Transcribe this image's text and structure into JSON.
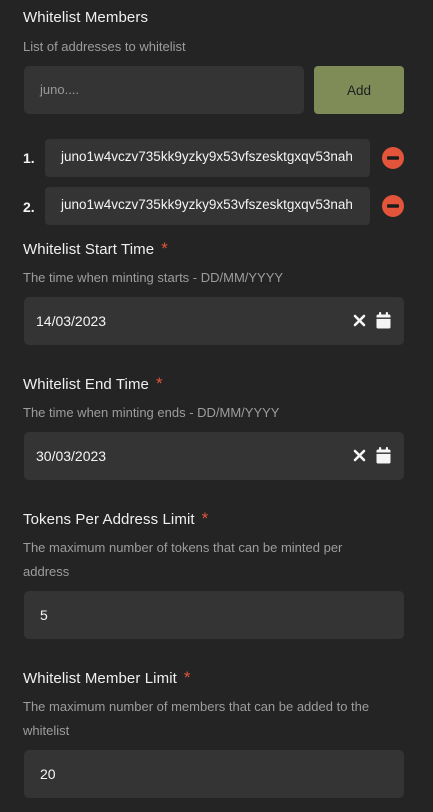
{
  "whitelist_members": {
    "title": "Whitelist Members",
    "description": "List of addresses to whitelist",
    "input_placeholder": "juno....",
    "add_label": "Add",
    "members": [
      {
        "num": "1.",
        "address": "juno1w4vczv735kk9yzky9x53vfszesktgxqv53nah"
      },
      {
        "num": "2.",
        "address": "juno1w4vczv735kk9yzky9x53vfszesktgxqv53nah"
      }
    ]
  },
  "start_time": {
    "title": "Whitelist Start Time",
    "required": "*",
    "description": "The time when minting starts - DD/MM/YYYY",
    "value": "14/03/2023"
  },
  "end_time": {
    "title": "Whitelist End Time",
    "required": "*",
    "description": "The time when minting ends - DD/MM/YYYY",
    "value": "30/03/2023"
  },
  "tokens_limit": {
    "title": "Tokens Per Address Limit",
    "required": "*",
    "description_line1": "The maximum number of tokens that can be minted per",
    "description_line2": "address",
    "value": "5"
  },
  "member_limit": {
    "title": "Whitelist Member Limit",
    "required": "*",
    "description_line1": "The maximum number of members that can be added to the",
    "description_line2": "whitelist",
    "value": "20"
  },
  "icons": {
    "remove": "minus-circle-icon",
    "clear": "close-icon",
    "calendar": "calendar-icon"
  },
  "colors": {
    "background": "#242424",
    "field": "#343434",
    "accent_button": "#7f8c58",
    "required": "#e2553a",
    "remove_icon": "#e2553a"
  }
}
